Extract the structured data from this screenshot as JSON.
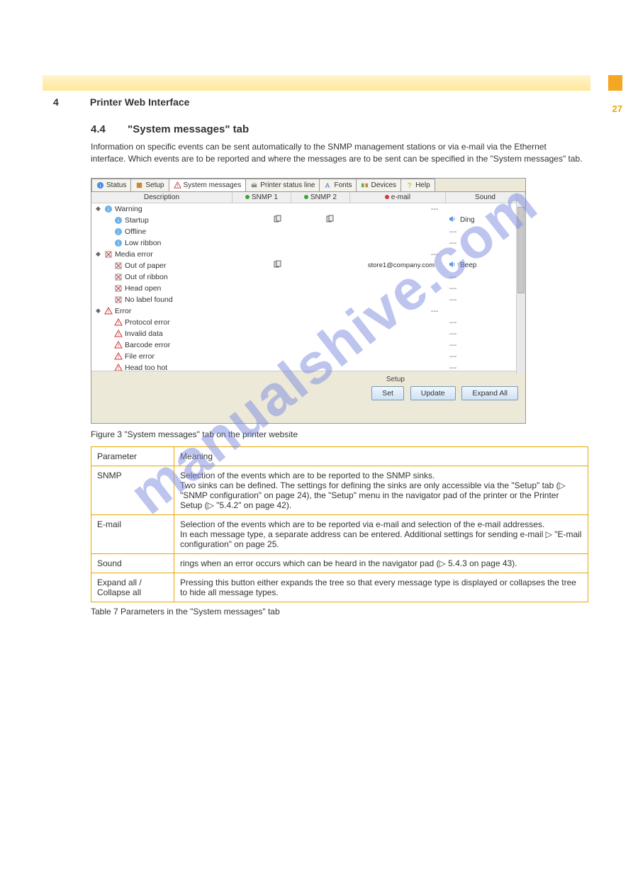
{
  "page_number_top": "27",
  "section_heading_number": "4",
  "section_heading_text": "Printer Web Interface",
  "subsection_number": "4.4",
  "subsection_title": "\"System messages\" tab",
  "intro_text": "Information on specific events can be sent automatically to the SNMP management stations or via e-mail via the Ethernet interface. Which events are to be reported and where the messages are to be sent can be specified in the \"System messages\" tab.",
  "figure_caption": "Figure 3   \"System messages\" tab on the printer website",
  "table_caption": "Table 7   Parameters in the \"System messages\" tab",
  "screenshot": {
    "tabs": [
      {
        "label": "Status",
        "icon": "info-icon"
      },
      {
        "label": "Setup",
        "icon": "setup-icon"
      },
      {
        "label": "System messages",
        "icon": "warning-icon",
        "active": true
      },
      {
        "label": "Printer status line",
        "icon": "printer-icon"
      },
      {
        "label": "Fonts",
        "icon": "font-icon"
      },
      {
        "label": "Devices",
        "icon": "devices-icon"
      },
      {
        "label": "Help",
        "icon": "help-icon"
      }
    ],
    "columns": {
      "description": "Description",
      "snmp1": "SNMP 1",
      "snmp2": "SNMP 2",
      "email": "e-mail",
      "sound": "Sound"
    },
    "rows": [
      {
        "indent": 0,
        "toggle": true,
        "icon": "info",
        "label": "Warning",
        "s1": "",
        "s2": "",
        "em": "",
        "sp": "---",
        "so": ""
      },
      {
        "indent": 1,
        "icon": "info",
        "label": "Startup",
        "s1": "snmp",
        "s2": "snmp",
        "em": "",
        "sp": "spk",
        "so": "Ding"
      },
      {
        "indent": 1,
        "icon": "info",
        "label": "Offline",
        "s1": "",
        "s2": "",
        "em": "",
        "sp": "---",
        "so": ""
      },
      {
        "indent": 1,
        "icon": "info",
        "label": "Low ribbon",
        "s1": "",
        "s2": "",
        "em": "",
        "sp": "---",
        "so": ""
      },
      {
        "indent": 0,
        "toggle": true,
        "icon": "media",
        "label": "Media error",
        "s1": "",
        "s2": "",
        "em": "",
        "sp": "---",
        "so": ""
      },
      {
        "indent": 1,
        "icon": "media",
        "label": "Out of paper",
        "s1": "snmp",
        "s2": "",
        "em": "store1@company.com",
        "sp": "spk",
        "so": "Beep"
      },
      {
        "indent": 1,
        "icon": "media",
        "label": "Out of ribbon",
        "s1": "",
        "s2": "",
        "em": "",
        "sp": "---",
        "so": ""
      },
      {
        "indent": 1,
        "icon": "media",
        "label": "Head open",
        "s1": "",
        "s2": "",
        "em": "",
        "sp": "---",
        "so": ""
      },
      {
        "indent": 1,
        "icon": "media",
        "label": "No label found",
        "s1": "",
        "s2": "",
        "em": "",
        "sp": "---",
        "so": ""
      },
      {
        "indent": 0,
        "toggle": true,
        "icon": "warn",
        "label": "Error",
        "s1": "",
        "s2": "",
        "em": "",
        "sp": "---",
        "so": ""
      },
      {
        "indent": 1,
        "icon": "warn",
        "label": "Protocol error",
        "s1": "",
        "s2": "",
        "em": "",
        "sp": "---",
        "so": ""
      },
      {
        "indent": 1,
        "icon": "warn",
        "label": "Invalid data",
        "s1": "",
        "s2": "",
        "em": "",
        "sp": "---",
        "so": ""
      },
      {
        "indent": 1,
        "icon": "warn",
        "label": "Barcode error",
        "s1": "",
        "s2": "",
        "em": "",
        "sp": "---",
        "so": ""
      },
      {
        "indent": 1,
        "icon": "warn",
        "label": "File error",
        "s1": "",
        "s2": "",
        "em": "",
        "sp": "---",
        "so": ""
      },
      {
        "indent": 1,
        "icon": "warn",
        "label": "Head too hot",
        "s1": "",
        "s2": "",
        "em": "",
        "sp": "---",
        "so": ""
      }
    ],
    "footer": {
      "setup_label": "Setup",
      "set": "Set",
      "update": "Update",
      "expand": "Expand All"
    }
  },
  "config_table": {
    "header": {
      "param": "Parameter",
      "meaning": "Meaning"
    },
    "rows": [
      {
        "param": "SNMP",
        "meaning_lines": [
          "Selection of the events which are to be reported to the SNMP sinks.",
          "Two sinks can be defined. The settings for defining the sinks are only accessible via the \"Setup\" tab (▷ \"SNMP configuration\" on page 24), the \"Setup\" menu in the navigator pad of the printer or the Printer Setup (▷ \"5.4.2\" on page 42)."
        ]
      },
      {
        "param": "E-mail",
        "meaning_lines": [
          "Selection of the events which are to be reported via e-mail and selection of the e-mail addresses.",
          "In each message type, a separate address can be entered. Additional settings for sending e-mail ▷ \"E-mail configuration\" on page 25."
        ]
      },
      {
        "param": "Sound",
        "meaning_lines": [
          "rings when an error occurs which can be heard in the navigator pad (▷ 5.4.3 on page 43)."
        ]
      },
      {
        "param": "Expand all / Collapse all",
        "meaning_lines": [
          "Pressing this button either expands the tree so that every message type is displayed or collapses the tree to hide all message types."
        ]
      }
    ]
  },
  "watermark": "manualshive.com"
}
